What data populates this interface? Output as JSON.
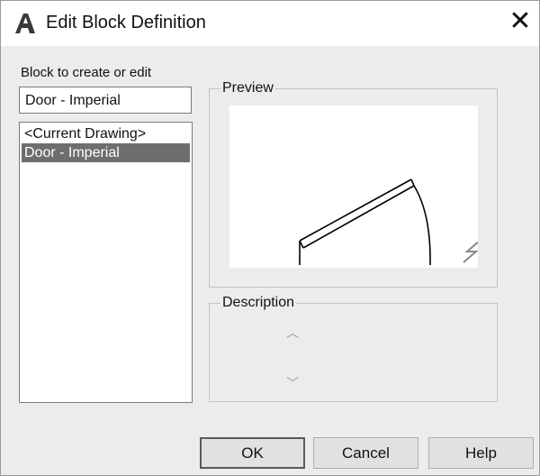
{
  "window": {
    "title": "Edit Block Definition",
    "app_icon": "autocad-a-icon",
    "close_icon": "close-icon"
  },
  "block_section": {
    "label": "Block to create or edit",
    "input_value": "Door - Imperial",
    "list_items": [
      "<Current Drawing>",
      "Door - Imperial"
    ],
    "selected_item": "Door - Imperial"
  },
  "preview": {
    "title": "Preview",
    "corner_icon": "lightning-icon"
  },
  "description": {
    "title": "Description",
    "scroll_up_icon": "chevron-up-icon",
    "scroll_down_icon": "chevron-down-icon"
  },
  "buttons": {
    "ok": "OK",
    "cancel": "Cancel",
    "help": "Help"
  },
  "colors": {
    "selection_bg": "#6e6e6e",
    "dialog_bg": "#ececec"
  }
}
